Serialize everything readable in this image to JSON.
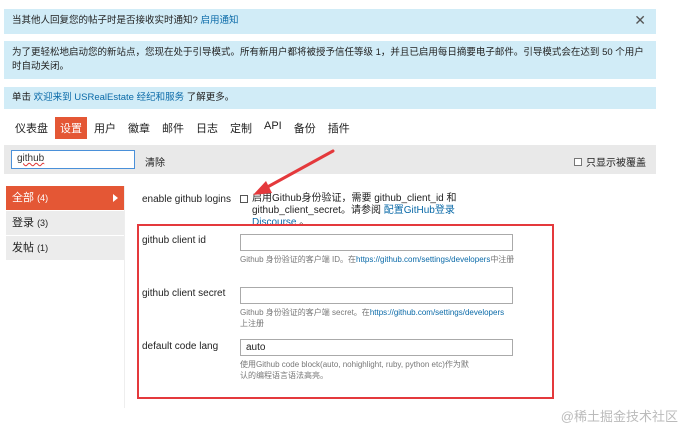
{
  "banners": {
    "notify_text": "当其他人回复您的帖子时是否接收实时通知?",
    "notify_link": "启用通知",
    "bootstrap_text": "为了更轻松地启动您的新站点，您现在处于引导模式。所有新用户都将被授予信任等级 1，并且已启用每日摘要电子邮件。引导模式会在达到 50 个用户时自动关闭。",
    "welcome_prefix": "单击",
    "welcome_link": "欢迎来到 USRealEstate 经纪和服务",
    "welcome_suffix": "了解更多。",
    "close_glyph": "✕"
  },
  "tabs": [
    {
      "label": "仪表盘"
    },
    {
      "label": "设置"
    },
    {
      "label": "用户"
    },
    {
      "label": "徽章"
    },
    {
      "label": "邮件"
    },
    {
      "label": "日志"
    },
    {
      "label": "定制"
    },
    {
      "label": "API"
    },
    {
      "label": "备份"
    },
    {
      "label": "插件"
    }
  ],
  "filter": {
    "search_value": "github",
    "clear_label": "清除",
    "only_overridden_label": "只显示被覆盖"
  },
  "sidebar": {
    "items": [
      {
        "label": "全部",
        "count": "(4)"
      },
      {
        "label": "登录",
        "count": "(3)"
      },
      {
        "label": "发帖",
        "count": "(1)"
      }
    ]
  },
  "settings": {
    "enable": {
      "label": "enable github logins",
      "desc_line1": "启用Github身份验证，需要 github_client_id 和",
      "desc_line2": "github_client_secret。请参阅",
      "desc_link": "配置GitHub登录Discourse",
      "desc_end": "。"
    },
    "client_id": {
      "label": "github client id",
      "value": "",
      "help_prefix": "Github 身份验证的客户端 ID。在",
      "help_link": "https://github.com/settings/developers",
      "help_suffix": "中注册"
    },
    "client_secret": {
      "label": "github client secret",
      "value": "",
      "help_prefix": "Github 身份验证的客户端 secret。在",
      "help_link": "https://github.com/settings/developers",
      "help_suffix": "上注册"
    },
    "code_lang": {
      "label": "default code lang",
      "value": "auto",
      "help": "使用Github code block(auto, nohighlight, ruby, python etc)作为默认的编程语言语法高亮。"
    }
  },
  "watermark": "@稀土掘金技术社区",
  "colors": {
    "accent": "#e45735",
    "banner_bg": "#d1ecf7",
    "annotation_red": "#e4393c"
  }
}
